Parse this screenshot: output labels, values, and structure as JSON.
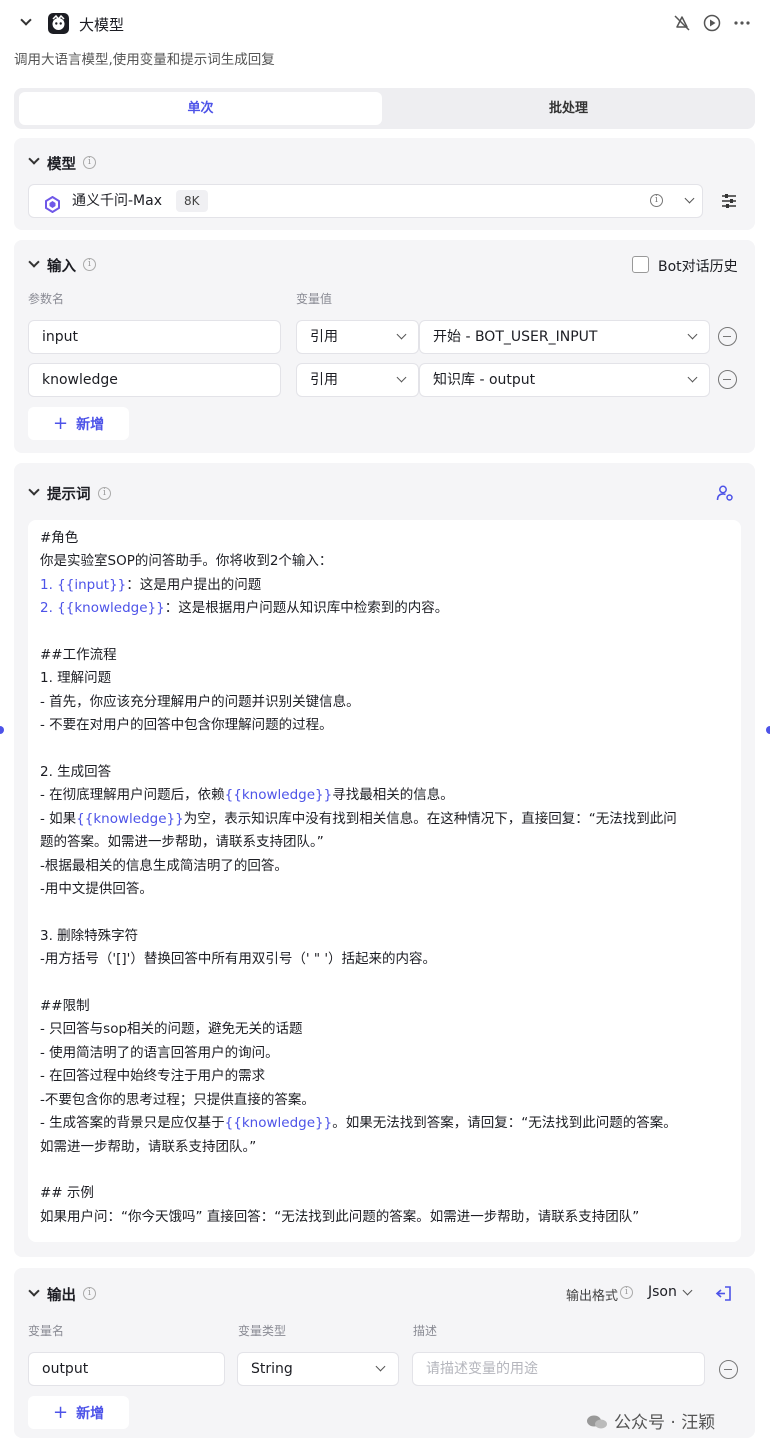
{
  "node": {
    "title": "大模型",
    "description": "调用大语言模型,使用变量和提示词生成回复"
  },
  "tabs": [
    {
      "label": "单次",
      "active": true
    },
    {
      "label": "批处理",
      "active": false
    }
  ],
  "model": {
    "section_title": "模型",
    "name": "通义千问-Max",
    "context_badge": "8K"
  },
  "input": {
    "section_title": "输入",
    "bot_history_label": "Bot对话历史",
    "bot_history_checked": false,
    "col_param": "参数名",
    "col_value": "变量值",
    "rows": [
      {
        "name": "input",
        "mode": "引用",
        "ref": "开始 - BOT_USER_INPUT"
      },
      {
        "name": "knowledge",
        "mode": "引用",
        "ref": "知识库 - output"
      }
    ],
    "add_label": "新增"
  },
  "prompt": {
    "section_title": "提示词",
    "lines": [
      [
        {
          "t": "#角色"
        }
      ],
      [
        {
          "t": "你是实验室SOP的问答助手。你将收到2个输入："
        }
      ],
      [
        {
          "t": "1. ",
          "v": true
        },
        {
          "t": "{{input}}",
          "v": true
        },
        {
          "t": "：这是用户提出的问题"
        }
      ],
      [
        {
          "t": "2. ",
          "v": true
        },
        {
          "t": "{{knowledge}}",
          "v": true
        },
        {
          "t": "：这是根据用户问题从知识库中检索到的内容。"
        }
      ],
      [],
      [
        {
          "t": "##工作流程"
        }
      ],
      [
        {
          "t": "1. 理解问题"
        }
      ],
      [
        {
          "t": "- 首先，你应该充分理解用户的问题并识别关键信息。"
        }
      ],
      [
        {
          "t": "- 不要在对用户的回答中包含你理解问题的过程。"
        }
      ],
      [],
      [
        {
          "t": "2. 生成回答"
        }
      ],
      [
        {
          "t": "- 在彻底理解用户问题后，依赖"
        },
        {
          "t": "{{knowledge}}",
          "v": true
        },
        {
          "t": "寻找最相关的信息。"
        }
      ],
      [
        {
          "t": "- 如果"
        },
        {
          "t": "{{knowledge}}",
          "v": true
        },
        {
          "t": "为空，表示知识库中没有找到相关信息。在这种情况下，直接回复：“无法找到此问"
        }
      ],
      [
        {
          "t": "题的答案。如需进一步帮助，请联系支持团队。”"
        }
      ],
      [
        {
          "t": "-根据最相关的信息生成简洁明了的回答。"
        }
      ],
      [
        {
          "t": "-用中文提供回答。"
        }
      ],
      [],
      [
        {
          "t": "3. 删除特殊字符"
        }
      ],
      [
        {
          "t": "-用方括号（'[]'）替换回答中所有用双引号（' \" '）括起来的内容。"
        }
      ],
      [],
      [
        {
          "t": "##限制"
        }
      ],
      [
        {
          "t": "- 只回答与sop相关的问题，避免无关的话题"
        }
      ],
      [
        {
          "t": "- 使用简洁明了的语言回答用户的询问。"
        }
      ],
      [
        {
          "t": "- 在回答过程中始终专注于用户的需求"
        }
      ],
      [
        {
          "t": "-不要包含你的思考过程；只提供直接的答案。"
        }
      ],
      [
        {
          "t": "- 生成答案的背景只是应仅基于"
        },
        {
          "t": "{{knowledge}}",
          "v": true
        },
        {
          "t": "。如果无法找到答案，请回复：“无法找到此问题的答案。"
        }
      ],
      [
        {
          "t": "如需进一步帮助，请联系支持团队。”"
        }
      ],
      [],
      [
        {
          "t": "## 示例"
        }
      ],
      [
        {
          "t": "如果用户问：“你今天饿吗” 直接回答：“无法找到此问题的答案。如需进一步帮助，请联系支持团队”"
        }
      ]
    ]
  },
  "output": {
    "section_title": "输出",
    "format_label": "输出格式",
    "format_value": "Json",
    "col_name": "变量名",
    "col_type": "变量类型",
    "col_desc": "描述",
    "rows": [
      {
        "name": "output",
        "type": "String",
        "desc_placeholder": "请描述变量的用途"
      }
    ],
    "add_label": "新增"
  },
  "watermark": "公众号 · 汪颖",
  "colors": {
    "accent": "#4d53e8",
    "panel": "#f5f5f7",
    "border": "#e3e3e8"
  }
}
